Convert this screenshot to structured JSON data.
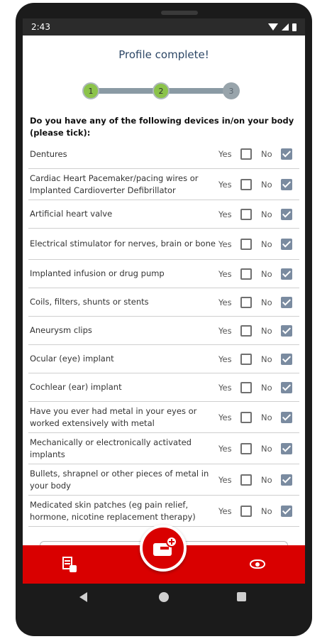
{
  "status": {
    "time": "2:43"
  },
  "title": "Profile complete!",
  "stepper": {
    "steps": [
      "1",
      "2",
      "3"
    ],
    "completed": 2
  },
  "question": "Do you have any of the following devices in/on your body (please tick):",
  "options": {
    "yes": "Yes",
    "no": "No"
  },
  "rows": [
    {
      "label": "Dentures",
      "yes": false,
      "no": true
    },
    {
      "label": "Cardiac Heart Pacemaker/pacing wires or Implanted Cardioverter Defibrillator",
      "yes": false,
      "no": true
    },
    {
      "label": "Artificial heart valve",
      "yes": false,
      "no": true
    },
    {
      "label": "Electrical stimulator for nerves, brain or bone",
      "yes": false,
      "no": true
    },
    {
      "label": "Implanted infusion or drug pump",
      "yes": false,
      "no": true
    },
    {
      "label": "Coils, filters, shunts or stents",
      "yes": false,
      "no": true
    },
    {
      "label": "Aneurysm clips",
      "yes": false,
      "no": true
    },
    {
      "label": "Ocular (eye) implant",
      "yes": false,
      "no": true
    },
    {
      "label": "Cochlear (ear) implant",
      "yes": false,
      "no": true
    },
    {
      "label": "Have you ever had metal in your eyes or worked extensively with metal",
      "yes": false,
      "no": true
    },
    {
      "label": "Mechanically or electronically activated implants",
      "yes": false,
      "no": true
    },
    {
      "label": "Bullets, shrapnel or other pieces of metal in your body",
      "yes": false,
      "no": true
    },
    {
      "label": "Medicated skin patches (eg pain relief, hormone, nicotine replacement therapy)",
      "yes": false,
      "no": true
    }
  ],
  "colors": {
    "accent": "#d90000",
    "step_done": "#8bc34a",
    "checkbox_checked": "#7a8ba0",
    "title": "#2d4766"
  },
  "bottom_nav": {
    "left_icon": "edit-document-icon",
    "center_icon": "add-card-icon",
    "right_icon": "eye-icon"
  }
}
